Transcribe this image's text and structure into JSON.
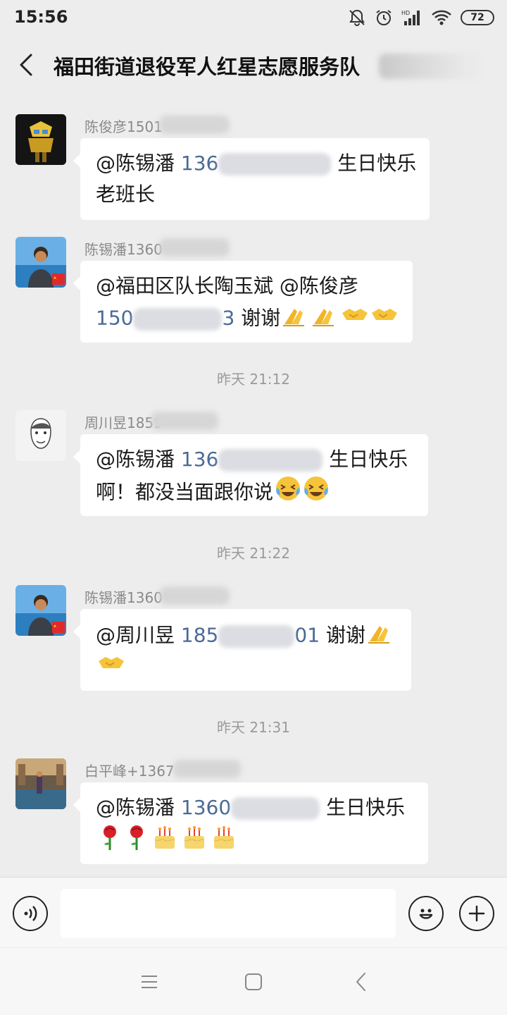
{
  "status": {
    "time": "15:56",
    "battery": "72",
    "icons": [
      "mute-icon",
      "alarm-icon",
      "signal-hd-icon",
      "wifi-icon",
      "battery-icon"
    ]
  },
  "nav": {
    "back_icon": "chevron-left-icon",
    "title": "福田街道退役军人红星志愿服务队"
  },
  "messages": [
    {
      "sender": "陈俊彦1501",
      "lines": [
        {
          "mention": "@陈锡潘",
          "phone": "136",
          "tail": "生日快乐"
        },
        {
          "text": "老班长"
        }
      ]
    },
    {
      "sender": "陈锡潘1360",
      "lines": [
        {
          "text": "@福田区队长陶玉斌 @陈俊彦"
        },
        {
          "phone": "150",
          "phone_tail": "3",
          "tail": "谢谢"
        }
      ]
    },
    {
      "sender": "周川昱1859",
      "lines": [
        {
          "mention": "@陈锡潘",
          "phone": "136",
          "tail": "生日快乐"
        },
        {
          "text": "啊！都没当面跟你说"
        }
      ]
    },
    {
      "sender": "陈锡潘1360",
      "lines": [
        {
          "mention": "@周川昱",
          "phone": "185",
          "phone_tail": "01",
          "tail": "谢谢"
        },
        {
          "text": ""
        }
      ]
    },
    {
      "sender": "白平峰+1367",
      "lines": [
        {
          "mention": "@陈锡潘",
          "phone": "1360",
          "tail": "生日快乐"
        },
        {
          "text": ""
        }
      ]
    }
  ],
  "timestamps": [
    "昨天 21:12",
    "昨天 21:22",
    "昨天 21:31"
  ],
  "input": {
    "voice_icon": "voice-icon",
    "placeholder": "",
    "emoji_icon": "smiley-icon",
    "plus_icon": "plus-icon"
  },
  "system_nav": [
    "menu-icon",
    "home-icon",
    "back-icon"
  ]
}
